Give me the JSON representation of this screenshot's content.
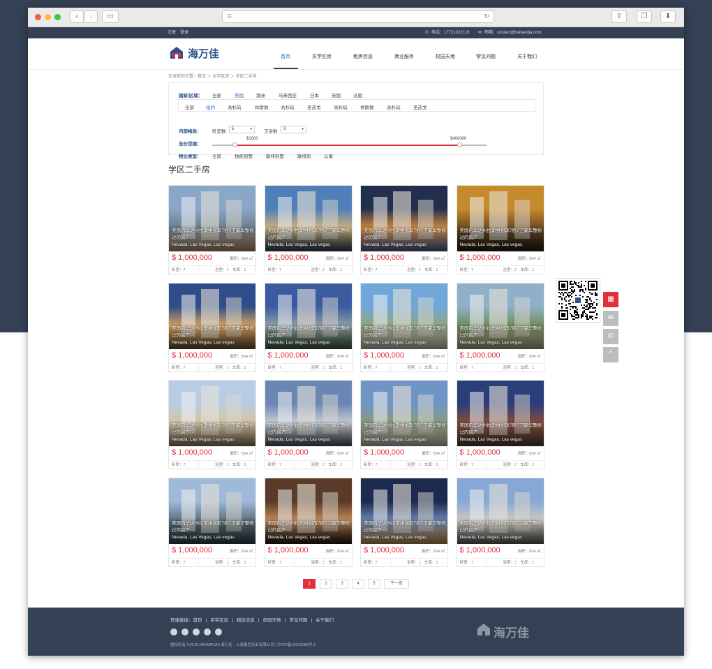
{
  "topbar": {
    "register": "注册",
    "login": "登录",
    "phone": "电话：17721022119",
    "email": "邮箱：contact@haiwanjia.com"
  },
  "logo": {
    "text": "海万佳"
  },
  "nav": [
    "首页",
    "买学区房",
    "租房信息",
    "商业服务",
    "校园天地",
    "常见问题",
    "关于我们"
  ],
  "breadcrumb": "您当前的位置：首页 ＞ 买学区房 ＞ 学区二手房",
  "filter": {
    "region_label": "国家/区域：",
    "regions": [
      "全部",
      "美国",
      "澳洲",
      "马来西亚",
      "日本",
      "英国",
      "法国"
    ],
    "cities": [
      "全部",
      "纽约",
      "洛杉矶",
      "休斯敦",
      "洛杉矶",
      "圣迭戈",
      "洛杉矶",
      "休斯敦",
      "洛杉矶",
      "圣迭戈"
    ],
    "layout_label": "内部格局：",
    "bedroom_label": "卧室数",
    "bedroom_value": "5",
    "bathroom_label": "卫浴数",
    "bathroom_value": "3",
    "price_label": "总价范围：",
    "price_min": "$1000",
    "price_max": "$400000",
    "type_label": "物业类型：",
    "types": [
      "全部",
      "独栋别墅",
      "联排别墅",
      "联排房",
      "公寓"
    ]
  },
  "section_title": "学区二手房",
  "listing": {
    "title": "美国内华达州拉斯维加斯7卧7卫豪华整修过的房产",
    "location": "Nevada, Las Vegas, Las vegas",
    "price": "$ 1,000,000",
    "area": "面积：654 ㎡",
    "bed": "卧室：7",
    "bath": "浴室：3",
    "garage": "车库：1"
  },
  "pagination": [
    "1",
    "2",
    "3",
    "4",
    "5",
    "下一页"
  ],
  "footer": {
    "links_label": "快速链接：",
    "links": [
      "首页",
      "买学区房",
      "租房信息",
      "校园天地",
      "常见问题",
      "关于我们"
    ],
    "copyright": "版权所有 ©2016 HAIWANJIA 海万佳 - 上海善生实业有限公司 | 沪ICP备13012086号-5",
    "logo_text": "海万佳"
  },
  "colors": {
    "navy": "#344154",
    "accent": "#e0303a",
    "link": "#2b6cc4"
  }
}
